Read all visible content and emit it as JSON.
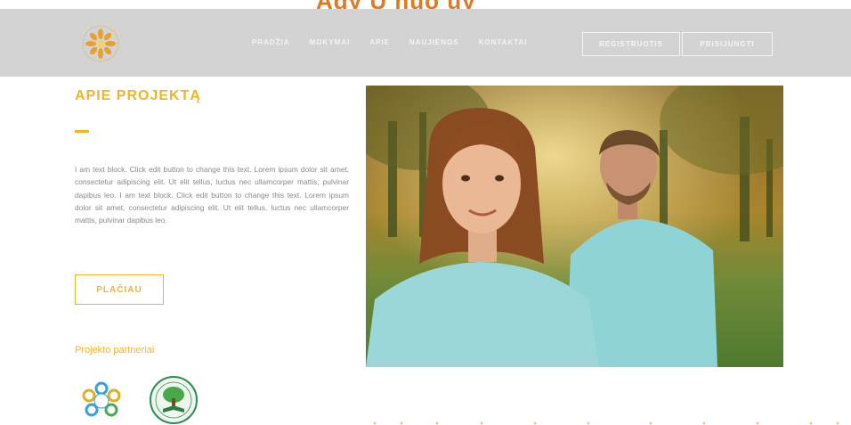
{
  "top": {
    "partial_heading": "Ady Ų nuo      uy"
  },
  "nav": {
    "items": [
      "PRADŽIA",
      "MOKYMAI",
      "APIE",
      "NAUJIENOS",
      "KONTAKTAI"
    ],
    "register_label": "REGISTRUOTIS",
    "login_label": "PRISIJUNGTI"
  },
  "about": {
    "title": "APIE PROJEKTĄ",
    "body": "I am text block. Click edit button to change this text. Lorem ipsum dolor sit amet, consectetur adipiscing elit. Ut elit tellus, luctus nec ullamcorper mattis, pulvinar dapibus leo. I am text block. Click edit button to change this text. Lorem ipsum dolor sit amet, consectetur adipiscing elit. Ut elit tellus, luctus nec ullamcorper mattis, pulvinar dapibus leo.",
    "button_label": "PLAČIAU"
  },
  "partners": {
    "title": "Projekto partneriai"
  },
  "colors": {
    "accent": "#f0b429",
    "navbar": "#d3d3d3",
    "body_text": "#8a8a8a"
  },
  "icons": [
    "logo-flower-icon",
    "partner-logo-circle-icon",
    "partner-logo-tree-icon"
  ]
}
